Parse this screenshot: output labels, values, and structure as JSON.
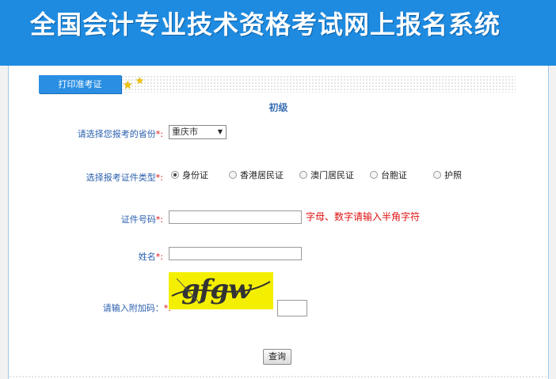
{
  "header": {
    "title": "全国会计专业技术资格考试网上报名系统"
  },
  "tab": {
    "label": "打印准考证"
  },
  "form": {
    "level": "初级",
    "province": {
      "label": "请选择您报考的省份",
      "required_mark": "*:",
      "value": "重庆市"
    },
    "id_type": {
      "label": "选择报考证件类型",
      "required_mark": "*:",
      "options": [
        "身份证",
        "香港居民证",
        "澳门居民证",
        "台胞证",
        "护照"
      ],
      "selected": "身份证"
    },
    "id_number": {
      "label": "证件号码",
      "required_mark": "*:",
      "value": "",
      "hint": "字母、数字请输入半角字符"
    },
    "name": {
      "label": "姓名",
      "required_mark": "*:",
      "value": ""
    },
    "captcha": {
      "label": "请输入附加码：",
      "required_mark": "*:",
      "image_text": "gfgw",
      "value": ""
    },
    "query_button": "查询"
  },
  "colors": {
    "header_bg": "#1e8be0",
    "tab_bg": "#2a8fe3",
    "label_text": "#2a5fae",
    "required": "#e01010",
    "captcha_bg": "#f4ef00"
  },
  "icons": [
    "star-icon",
    "star-icon",
    "chevron-down-icon",
    "radio-icon"
  ]
}
